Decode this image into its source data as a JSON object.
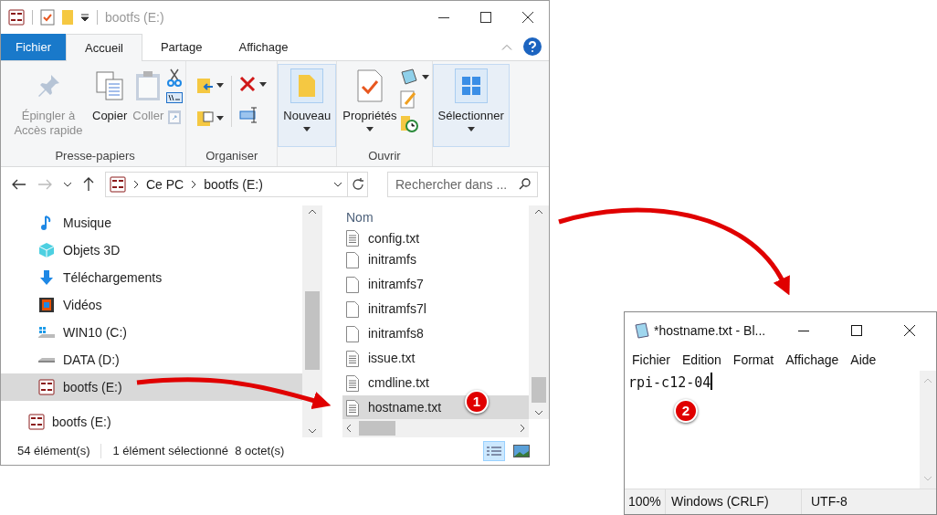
{
  "explorer": {
    "title": "bootfs (E:)",
    "tabs": [
      {
        "label": "Fichier",
        "kind": "file",
        "selected": false
      },
      {
        "label": "Accueil",
        "kind": "tab",
        "selected": true
      },
      {
        "label": "Partage",
        "kind": "tab",
        "selected": false
      },
      {
        "label": "Affichage",
        "kind": "tab",
        "selected": false
      }
    ],
    "ribbon": [
      {
        "label": "Presse-papiers",
        "highlighted": false,
        "buttons": [
          {
            "kind": "pin",
            "label": "Épingler à Accès rapide",
            "disabled": true,
            "dropdown": false
          },
          {
            "kind": "copy",
            "label": "Copier",
            "disabled": false,
            "dropdown": false
          },
          {
            "kind": "paste",
            "label": "Coller",
            "disabled": true,
            "dropdown": false
          }
        ]
      },
      {
        "label": "Organiser",
        "highlighted": false
      },
      {
        "highlighted": true,
        "buttons": [
          {
            "kind": "folder",
            "label": "Nouveau",
            "disabled": false,
            "dropdown": true
          }
        ]
      },
      {
        "label": "Ouvrir",
        "highlighted": false,
        "buttons": [
          {
            "kind": "properties",
            "label": "Propriétés",
            "disabled": false,
            "dropdown": true
          }
        ]
      },
      {
        "highlighted": true,
        "buttons": [
          {
            "kind": "select",
            "label": "Sélectionner",
            "disabled": false,
            "dropdown": true
          }
        ]
      }
    ],
    "breadcrumbs": [
      "Ce PC",
      "bootfs (E:)"
    ],
    "search": {
      "placeholder": "Rechercher dans ..."
    },
    "nav_items": [
      {
        "label": "Musique",
        "kind": "music",
        "selected": false
      },
      {
        "label": "Objets 3D",
        "kind": "cube",
        "selected": false
      },
      {
        "label": "Téléchargements",
        "kind": "download",
        "selected": false
      },
      {
        "label": "Vidéos",
        "kind": "video",
        "selected": false
      },
      {
        "label": "WIN10 (C:)",
        "kind": "windrive",
        "selected": false
      },
      {
        "label": "DATA (D:)",
        "kind": "drive",
        "selected": false
      },
      {
        "label": "bootfs (E:)",
        "kind": "sd",
        "selected": true
      }
    ],
    "nav_bottom_item": {
      "label": "bootfs (E:)"
    },
    "column": "Nom",
    "files": [
      {
        "name": "config.txt",
        "kind": "text",
        "selected": false
      },
      {
        "name": "initramfs",
        "kind": "blank",
        "selected": false
      },
      {
        "name": "initramfs7",
        "kind": "blank",
        "selected": false
      },
      {
        "name": "initramfs7l",
        "kind": "blank",
        "selected": false
      },
      {
        "name": "initramfs8",
        "kind": "blank",
        "selected": false
      },
      {
        "name": "issue.txt",
        "kind": "text",
        "selected": false
      },
      {
        "name": "cmdline.txt",
        "kind": "text",
        "selected": false
      },
      {
        "name": "hostname.txt",
        "kind": "text",
        "selected": true
      }
    ],
    "status": [
      "54 élément(s)",
      "1 élément sélectionné  8 octet(s)"
    ],
    "view_modes": [
      {
        "kind": "details",
        "selected": true
      },
      {
        "kind": "preview",
        "selected": false
      }
    ]
  },
  "notepad": {
    "title": "*hostname.txt - Bl...",
    "menu": [
      "Fichier",
      "Edition",
      "Format",
      "Affichage",
      "Aide"
    ],
    "content": "rpi-c12-04",
    "status": [
      "100%",
      "Windows (CRLF)",
      "UTF-8"
    ]
  },
  "markers": [
    "1",
    "2"
  ]
}
